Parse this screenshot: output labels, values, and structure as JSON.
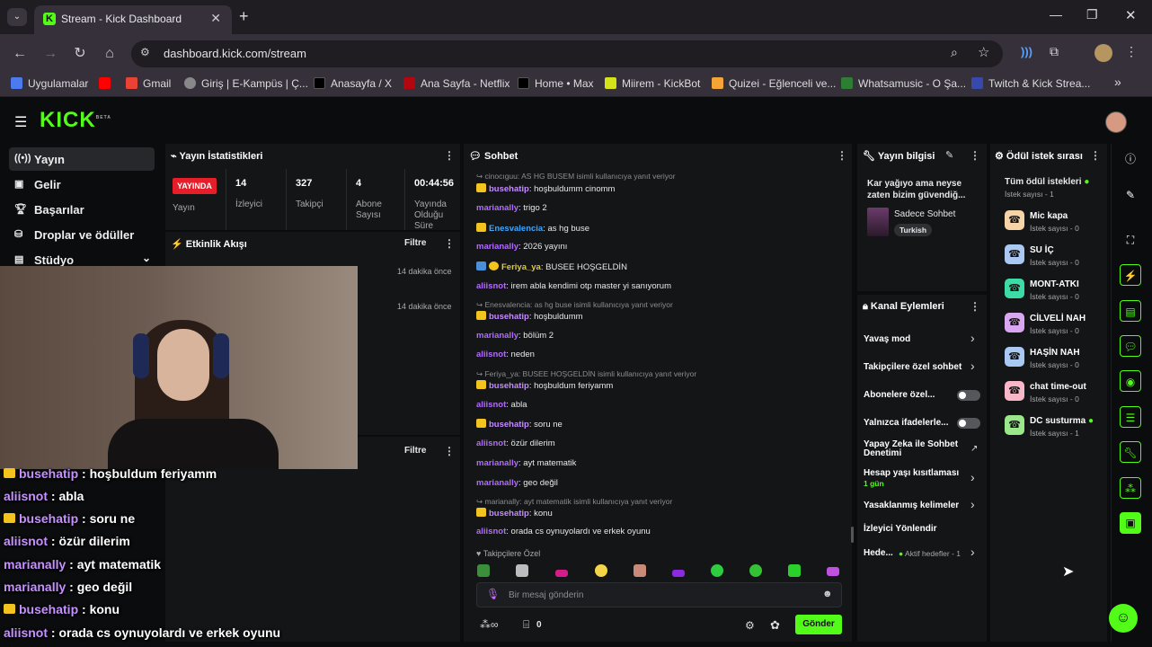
{
  "browser": {
    "tab_title": "Stream - Kick Dashboard",
    "url": "dashboard.kick.com/stream",
    "bookmarks": [
      "Uygulamalar",
      "Gmail",
      "Giriş | E-Kampüs | Ç...",
      "Anasayfa / X",
      "Ana Sayfa - Netflix",
      "Home • Max",
      "Miirem - KickBot",
      "Quizei - Eğlenceli ve...",
      "Whatsamusic - O Şa...",
      "Twitch & Kick Strea..."
    ]
  },
  "header": {
    "logo": "KICK",
    "logo_badge": "BETA"
  },
  "sidebar": {
    "items": [
      {
        "label": "Yayın"
      },
      {
        "label": "Gelir"
      },
      {
        "label": "Başarılar"
      },
      {
        "label": "Droplar ve ödüller"
      },
      {
        "label": "Stüdyo"
      }
    ]
  },
  "stats": {
    "title": "Yayın İstatistikleri",
    "live_badge": "YAYINDA",
    "live_label": "Yayın",
    "items": [
      {
        "value": "14",
        "label": "İzleyici"
      },
      {
        "value": "327",
        "label": "Takipçi"
      },
      {
        "value": "4",
        "label": "Abone Sayısı"
      },
      {
        "value": "00:44:56",
        "label": "Yayında Olduğu Süre"
      }
    ]
  },
  "activity": {
    "title": "Etkinlik Akışı",
    "filter": "Filtre",
    "times": [
      "14 dakika önce",
      "14 dakika önce"
    ],
    "filter2": "Filtre"
  },
  "chat": {
    "title": "Sohbet",
    "lines": [
      {
        "reply": "cinocıguu: AS HG BUSEM isimli kullanıcıya yanıt veriyor"
      },
      {
        "user": "busehatip",
        "text": ": hoşbuldumm cinomm",
        "crown": true
      },
      {
        "user": "marianally",
        "text": ": trigo 2"
      },
      {
        "user": "Enesvalencia",
        "text": ": as hg buse",
        "crown": true
      },
      {
        "user": "marianally",
        "text": ": 2026 yayını"
      },
      {
        "user": "Feriya_ya",
        "text": ": BUSEE HOŞGELDİN",
        "badges": true
      },
      {
        "user": "aliisnot",
        "text": ": irem abla kendimi otp master yi sanıyorum"
      },
      {
        "reply": "Enesvalencia: as hg buse isimli kullanıcıya yanıt veriyor"
      },
      {
        "user": "busehatip",
        "text": ": hoşbuldumm",
        "crown": true
      },
      {
        "user": "marianally",
        "text": ": bölüm 2"
      },
      {
        "user": "aliisnot",
        "text": ": neden"
      },
      {
        "reply": "Feriya_ya: BUSEE HOŞGELDİN isimli kullanıcıya yanıt veriyor"
      },
      {
        "user": "busehatip",
        "text": ": hoşbuldum feriyamm",
        "crown": true
      },
      {
        "user": "aliisnot",
        "text": ": abla"
      },
      {
        "user": "busehatip",
        "text": ": soru ne",
        "crown": true
      },
      {
        "user": "aliisnot",
        "text": ": özür dilerim"
      },
      {
        "user": "marianally",
        "text": ": ayt matematik"
      },
      {
        "user": "marianally",
        "text": ": geo değil"
      },
      {
        "reply": "marianally: ayt matematik isimli kullanıcıya yanıt veriyor"
      },
      {
        "user": "busehatip",
        "text": ": konu",
        "crown": true
      },
      {
        "user": "aliisnot",
        "text": ": orada cs oynuyolardı ve erkek oyunu"
      }
    ],
    "followers_only": "Takipçilere Özel",
    "input_placeholder": "Bir mesaj gönderin",
    "count": "0",
    "send": "Gönder"
  },
  "stream_info": {
    "title": "Yayın bilgisi",
    "stream_title": "Kar yağıyo ama neyse zaten bizim güvendiğ...",
    "category": "Sadece Sohbet",
    "language": "Turkish"
  },
  "channel_actions": {
    "title": "Kanal Eylemleri",
    "items": [
      "Yavaş mod",
      "Takipçilere özel sohbet",
      "Abonelere özel...",
      "Yalnızca ifadelerle...",
      "Yapay Zeka ile Sohbet Denetimi",
      "Hesap yaşı kısıtlaması",
      "Yasaklanmış kelimeler",
      "İzleyici Yönlendir",
      "Hede..."
    ],
    "age_sub": "1 gün",
    "goals": "Aktif hedefler - 1"
  },
  "rewards": {
    "title": "Ödül istek sırası",
    "all": "Tüm ödül istekleri",
    "all_sub": "İstek sayısı - 1",
    "items": [
      {
        "name": "Mic kapa",
        "sub": "İstek sayısı - 0",
        "color": "#f7d3a8"
      },
      {
        "name": "SU İÇ",
        "sub": "İstek sayısı - 0",
        "color": "#a9c8f2"
      },
      {
        "name": "MONT-ATKI",
        "sub": "İstek sayısı - 0",
        "color": "#3ddba6"
      },
      {
        "name": "CİLVELİ NAH",
        "sub": "İstek sayısı - 0",
        "color": "#d9a7f2"
      },
      {
        "name": "HAŞİN NAH",
        "sub": "İstek sayısı - 0",
        "color": "#a9c8f2"
      },
      {
        "name": "chat time-out",
        "sub": "İstek sayısı - 0",
        "color": "#f7b7c8"
      },
      {
        "name": "DC susturma",
        "sub": "İstek sayısı - 1",
        "color": "#9be88a"
      }
    ]
  },
  "overlay": {
    "lines": [
      {
        "user": "busehatip",
        "text": " : hoşbuldum feriyamm",
        "crown": true
      },
      {
        "user": "aliisnot",
        "text": " : abla"
      },
      {
        "user": "busehatip",
        "text": " : soru ne",
        "crown": true
      },
      {
        "user": "aliisnot",
        "text": " : özür dilerim"
      },
      {
        "user": "marianally",
        "text": " : ayt matematik"
      },
      {
        "user": "marianally",
        "text": " : geo değil"
      },
      {
        "user": "busehatip",
        "text": " : konu",
        "crown": true
      },
      {
        "user": "aliisnot",
        "text": " : orada cs oynuyolardı ve erkek oyunu"
      }
    ]
  }
}
